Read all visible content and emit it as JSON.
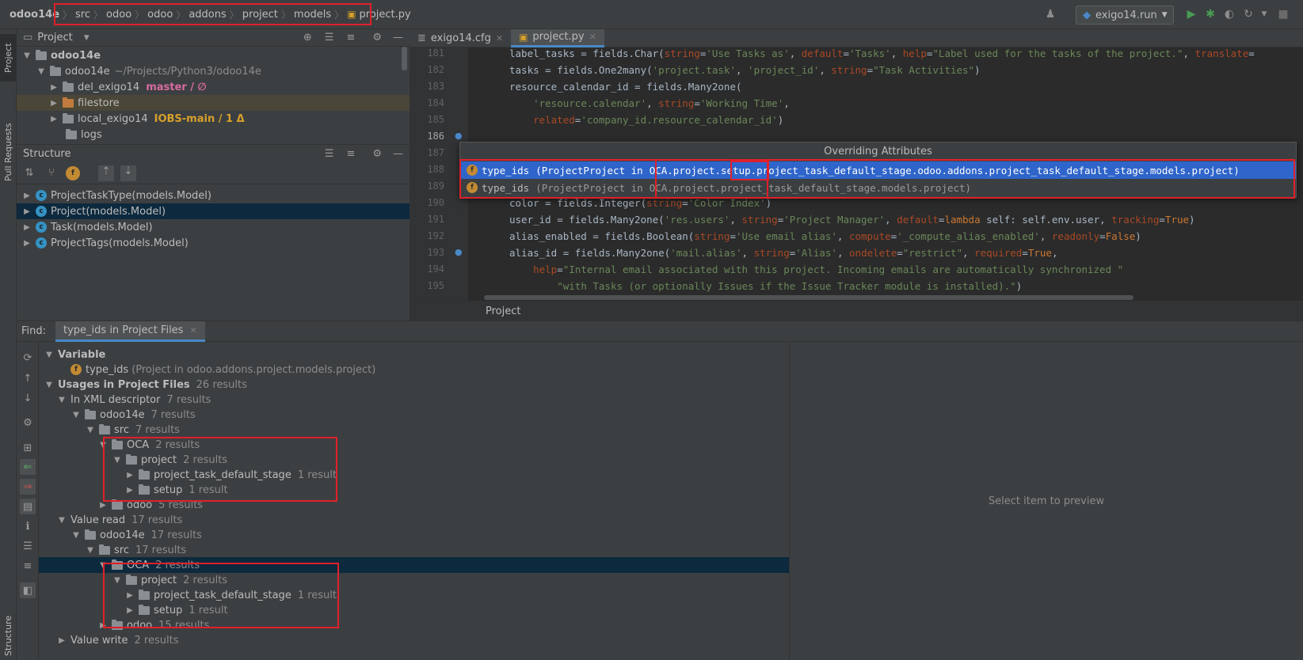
{
  "navbar": {
    "breadcrumb": [
      "odoo14e",
      "src",
      "odoo",
      "odoo",
      "addons",
      "project",
      "models",
      "project.py"
    ],
    "run_config": "exigo14.run"
  },
  "sidebar_tabs": {
    "project": "Project",
    "pull_requests": "Pull Requests",
    "structure": "Structure"
  },
  "project_panel": {
    "title": "Project",
    "tree": [
      {
        "name": "odoo14e",
        "extra": ""
      },
      {
        "name": "odoo14e",
        "extra": "~/Projects/Python3/odoo14e"
      },
      {
        "name": "del_exigo14",
        "branch": "master / ∅"
      },
      {
        "name": "filestore"
      },
      {
        "name": "local_exigo14",
        "branch": "IOBS-main / 1 Δ"
      },
      {
        "name": "logs"
      }
    ]
  },
  "structure_panel": {
    "title": "Structure",
    "items": [
      "ProjectTaskType(models.Model)",
      "Project(models.Model)",
      "Task(models.Model)",
      "ProjectTags(models.Model)"
    ]
  },
  "editor": {
    "tabs": [
      "exigo14.cfg",
      "project.py"
    ],
    "line_numbers": [
      "181",
      "182",
      "183",
      "184",
      "185",
      "186",
      "187",
      "188",
      "189",
      "190",
      "191",
      "192",
      "193",
      "194",
      "195"
    ],
    "breadcrumb": "Project"
  },
  "popup": {
    "title": "Overriding Attributes",
    "rows": [
      {
        "name": "type_ids",
        "cls": "(ProjectProject in",
        "loc": "OCA.project.setup.project_task_default_stage.odoo.addons.project_task_default_stage.models.project)"
      },
      {
        "name": "type_ids",
        "cls": "(ProjectProject in",
        "loc": "OCA.project.project_task_default_stage.models.project)"
      }
    ]
  },
  "find": {
    "label": "Find:",
    "tab": "type_ids in Project Files",
    "variable_header": "Variable",
    "variable_name": "type_ids",
    "variable_loc": "(Project in odoo.addons.project.models.project)",
    "usages": "Usages in Project Files",
    "usages_count": "26 results",
    "preview_text": "Select item to preview",
    "xml_group": {
      "label": "In XML descriptor",
      "count": "7 results"
    },
    "read_group": {
      "label": "Value read",
      "count": "17 results"
    },
    "write_group": {
      "label": "Value write",
      "count": "2 results"
    },
    "odoo14e_xml_count": "7 results",
    "src_xml_count": "7 results",
    "odoo14e_read_count": "17 results",
    "src_read_count": "17 results",
    "oca_count": "2 results",
    "project_count": "2 results",
    "ptds_count": "1 result",
    "setup_count": "1 result",
    "odoo_xml_count": "5 results",
    "odoo_read_count": "15 results",
    "labels": {
      "odoo14e": "odoo14e",
      "src": "src",
      "oca": "OCA",
      "project": "project",
      "ptds": "project_task_default_stage",
      "setup": "setup",
      "odoo": "odoo"
    }
  }
}
